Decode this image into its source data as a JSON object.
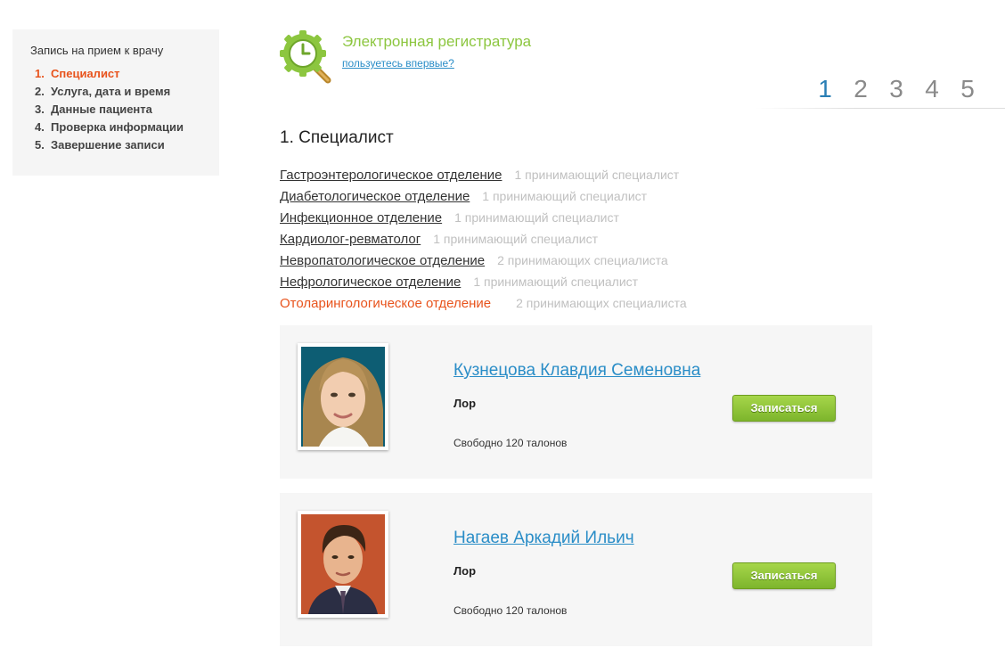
{
  "sidebar": {
    "title": "Запись на прием к врачу",
    "steps": [
      {
        "num": "1.",
        "label": "Специалист"
      },
      {
        "num": "2.",
        "label": "Услуга, дата и время"
      },
      {
        "num": "3.",
        "label": "Данные пациента"
      },
      {
        "num": "4.",
        "label": "Проверка информации"
      },
      {
        "num": "5.",
        "label": "Завершение записи"
      }
    ],
    "active_step": 1
  },
  "header": {
    "logo_icon": "clock-magnifier-icon",
    "title": "Электронная регистратура",
    "first_time_link": "пользуетесь впервые?"
  },
  "pager": {
    "pages": [
      "1",
      "2",
      "3",
      "4",
      "5"
    ],
    "active": "1"
  },
  "section": {
    "title": "1. Специалист"
  },
  "departments": [
    {
      "name": "Гастроэнтерологическое отделение",
      "count": "1 принимающий специалист"
    },
    {
      "name": "Диабетологическое отделение",
      "count": "1 принимающий специалист"
    },
    {
      "name": "Инфекционное отделение",
      "count": "1 принимающий специалист"
    },
    {
      "name": "Кардиолог-ревматолог",
      "count": "1 принимающий специалист"
    },
    {
      "name": "Невропатологическое отделение",
      "count": "2 принимающих специалиста"
    },
    {
      "name": "Нефрологическое отделение",
      "count": "1 принимающий специалист"
    },
    {
      "name": "Отоларингологическое отделение",
      "count": "2 принимающих специалиста"
    }
  ],
  "doctors": [
    {
      "name": "Кузнецова Клавдия Семеновна",
      "specialty": "Лор",
      "slots": "Свободно 120 талонов",
      "button": "Записаться"
    },
    {
      "name": "Нагаев Аркадий Ильич",
      "specialty": "Лор",
      "slots": "Свободно 120 талонов",
      "button": "Записаться"
    }
  ],
  "colors": {
    "accent_orange": "#e8531c",
    "link_blue": "#2a8dc7",
    "brand_green": "#8cc63f",
    "button_green": "#7db52c"
  }
}
